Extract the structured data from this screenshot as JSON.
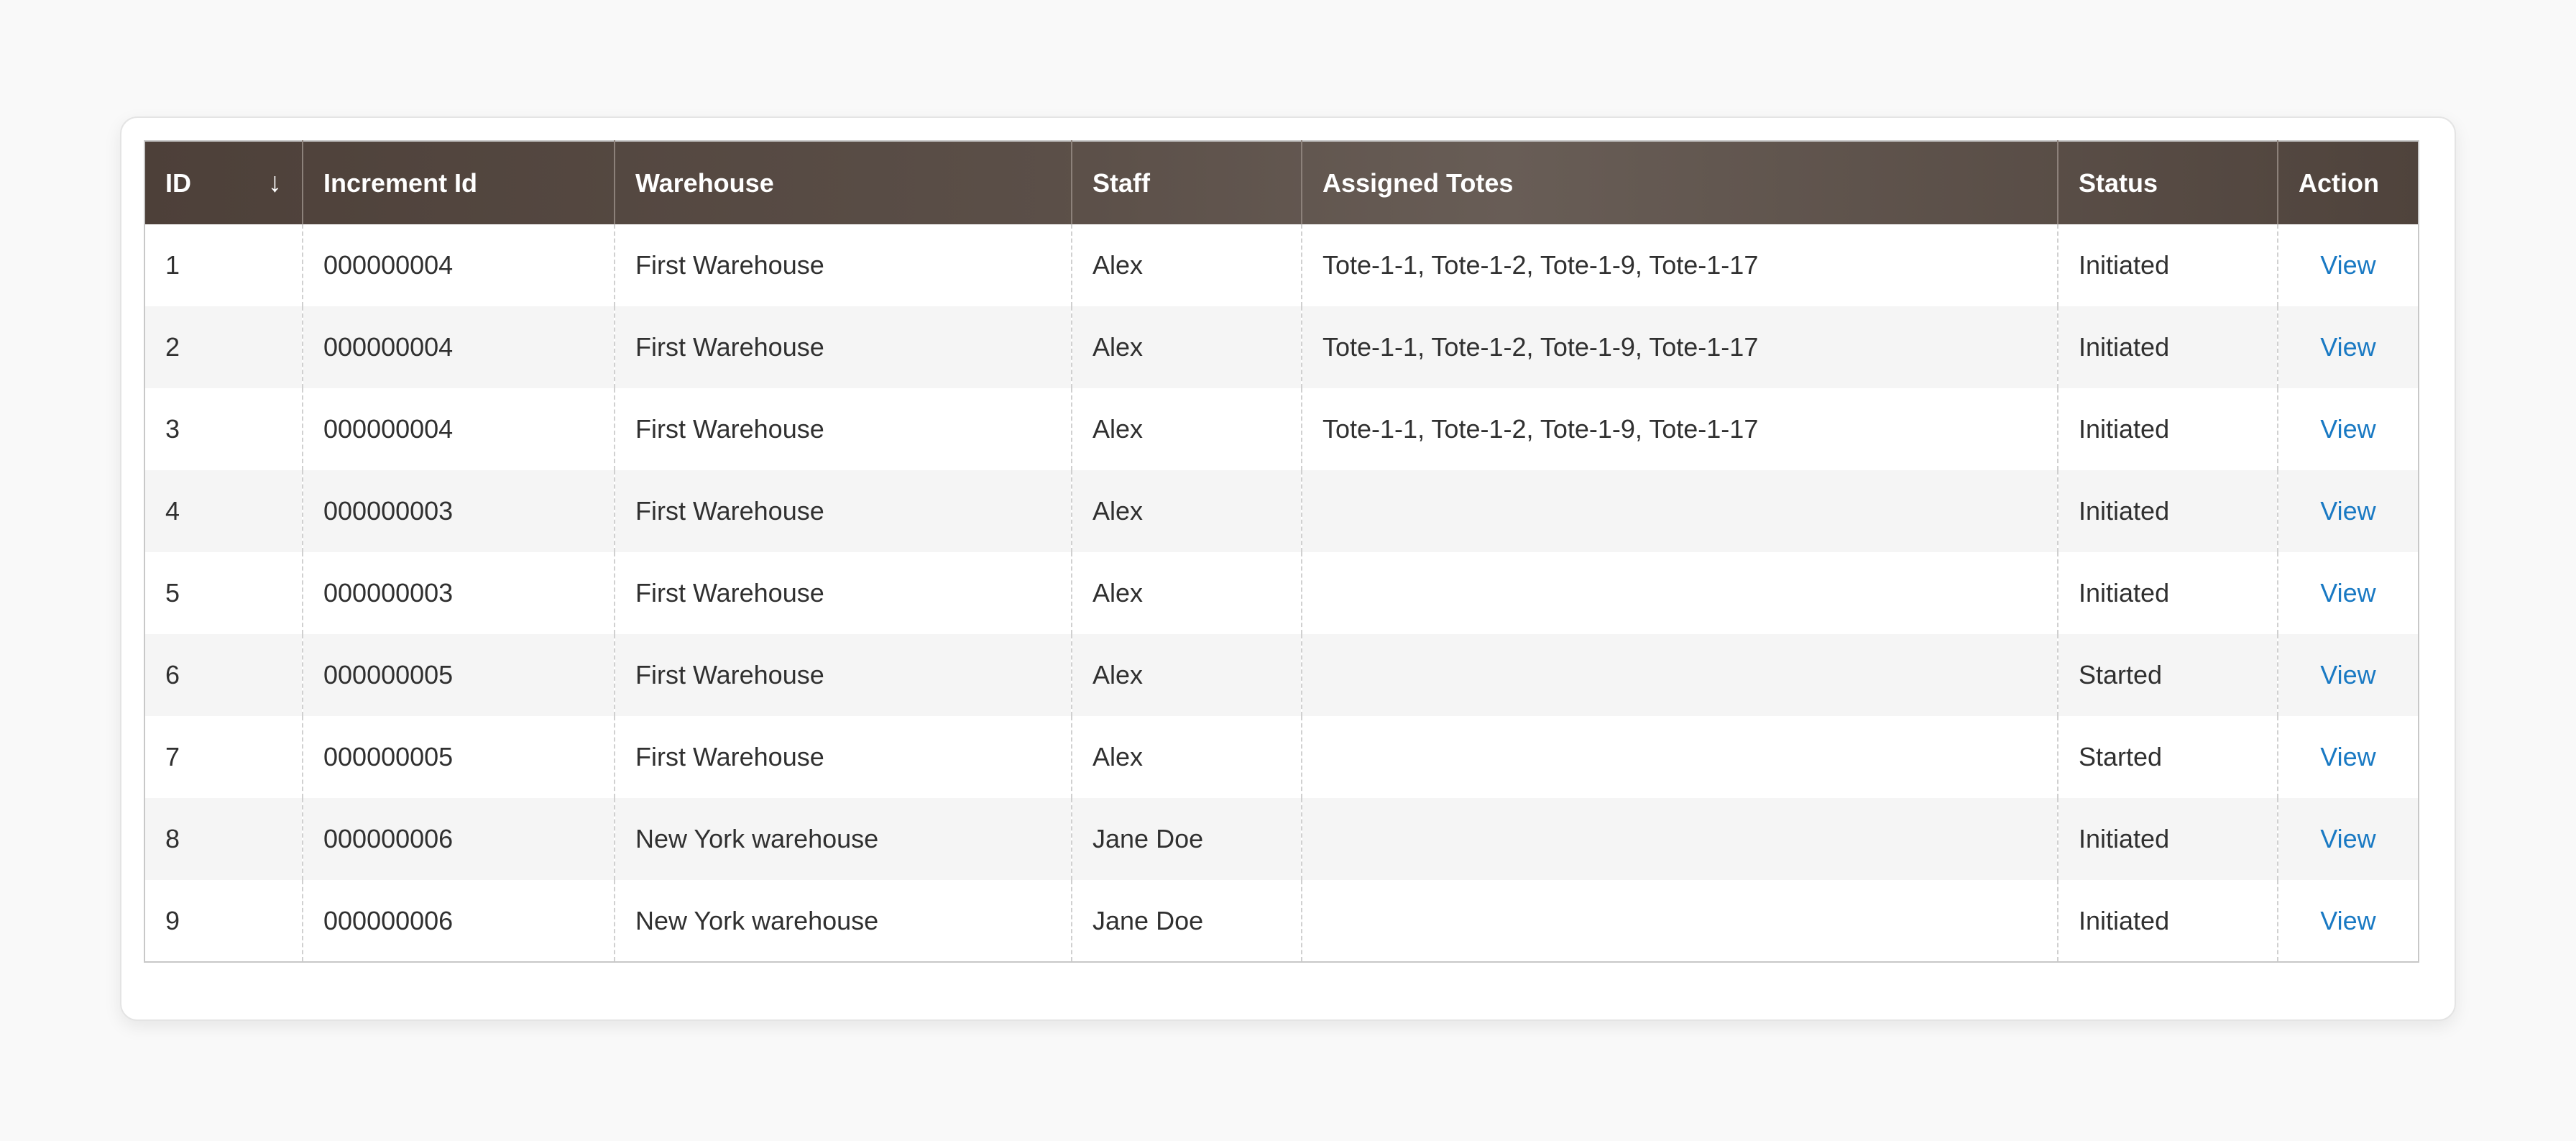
{
  "grid": {
    "columns": {
      "id": "ID",
      "increment_id": "Increment Id",
      "warehouse": "Warehouse",
      "staff": "Staff",
      "assigned_totes": "Assigned Totes",
      "status": "Status",
      "action": "Action"
    },
    "sort_indicator": "↓",
    "rows": [
      {
        "id": "1",
        "increment_id": "000000004",
        "warehouse": "First Warehouse",
        "staff": "Alex",
        "assigned_totes": "Tote-1-1, Tote-1-2, Tote-1-9, Tote-1-17",
        "status": "Initiated",
        "action": "View"
      },
      {
        "id": "2",
        "increment_id": "000000004",
        "warehouse": "First Warehouse",
        "staff": "Alex",
        "assigned_totes": "Tote-1-1, Tote-1-2, Tote-1-9, Tote-1-17",
        "status": "Initiated",
        "action": "View"
      },
      {
        "id": "3",
        "increment_id": "000000004",
        "warehouse": "First Warehouse",
        "staff": "Alex",
        "assigned_totes": "Tote-1-1, Tote-1-2, Tote-1-9, Tote-1-17",
        "status": "Initiated",
        "action": "View"
      },
      {
        "id": "4",
        "increment_id": "000000003",
        "warehouse": "First Warehouse",
        "staff": "Alex",
        "assigned_totes": "",
        "status": "Initiated",
        "action": "View"
      },
      {
        "id": "5",
        "increment_id": "000000003",
        "warehouse": "First Warehouse",
        "staff": "Alex",
        "assigned_totes": "",
        "status": "Initiated",
        "action": "View"
      },
      {
        "id": "6",
        "increment_id": "000000005",
        "warehouse": "First Warehouse",
        "staff": "Alex",
        "assigned_totes": "",
        "status": "Started",
        "action": "View"
      },
      {
        "id": "7",
        "increment_id": "000000005",
        "warehouse": "First Warehouse",
        "staff": "Alex",
        "assigned_totes": "",
        "status": "Started",
        "action": "View"
      },
      {
        "id": "8",
        "increment_id": "000000006",
        "warehouse": "New York warehouse",
        "staff": "Jane Doe",
        "assigned_totes": "",
        "status": "Initiated",
        "action": "View"
      },
      {
        "id": "9",
        "increment_id": "000000006",
        "warehouse": "New York warehouse",
        "staff": "Jane Doe",
        "assigned_totes": "",
        "status": "Initiated",
        "action": "View"
      }
    ]
  },
  "colors": {
    "header_bg": "#514540",
    "link": "#1979c3",
    "row_alt": "#f5f5f5"
  }
}
